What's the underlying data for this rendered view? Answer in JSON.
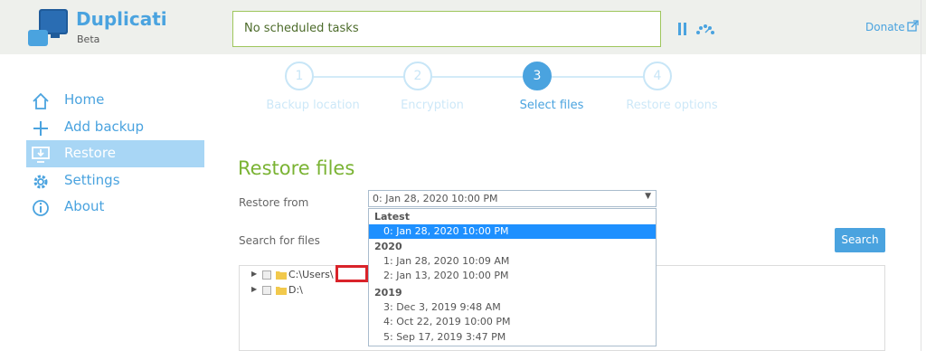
{
  "app": {
    "title": "Duplicati",
    "subtitle": "Beta",
    "status_text": "No scheduled tasks",
    "donate_label": "Donate"
  },
  "sidebar": {
    "items": [
      {
        "label": "Home",
        "icon": "home-icon"
      },
      {
        "label": "Add backup",
        "icon": "plus-icon"
      },
      {
        "label": "Restore",
        "icon": "restore-icon",
        "active": true
      },
      {
        "label": "Settings",
        "icon": "gear-icon"
      },
      {
        "label": "About",
        "icon": "info-icon"
      }
    ]
  },
  "stepper": {
    "steps": [
      {
        "number": "1",
        "label": "Backup location"
      },
      {
        "number": "2",
        "label": "Encryption"
      },
      {
        "number": "3",
        "label": "Select files",
        "active": true
      },
      {
        "number": "4",
        "label": "Restore options"
      }
    ]
  },
  "main": {
    "title": "Restore files",
    "restore_from_label": "Restore from",
    "restore_from_value": "0: Jan 28, 2020 10:00 PM",
    "search_label": "Search for files",
    "search_button": "Search"
  },
  "tree": {
    "rows": [
      {
        "path": "C:\\Users\\"
      },
      {
        "path": "D:\\"
      }
    ]
  },
  "dropdown": {
    "groups": [
      {
        "label": "Latest",
        "options": [
          "0: Jan 28, 2020 10:00 PM"
        ]
      },
      {
        "label": "2020",
        "options": [
          "1: Jan 28, 2020 10:09 AM",
          "2: Jan 13, 2020 10:00 PM"
        ]
      },
      {
        "label": "2019",
        "options": [
          "3: Dec 3, 2019 9:48 AM",
          "4: Oct 22, 2019 10:00 PM",
          "5: Sep 17, 2019 3:47 PM"
        ]
      }
    ],
    "selected": "0: Jan 28, 2020 10:00 PM"
  },
  "colors": {
    "accent": "#4aa3df",
    "title_green": "#7ab333",
    "header_bg": "#eef0ec",
    "active_nav": "#a8d6f5",
    "selected_option": "#1e90ff",
    "redaction": "#d9232a"
  }
}
